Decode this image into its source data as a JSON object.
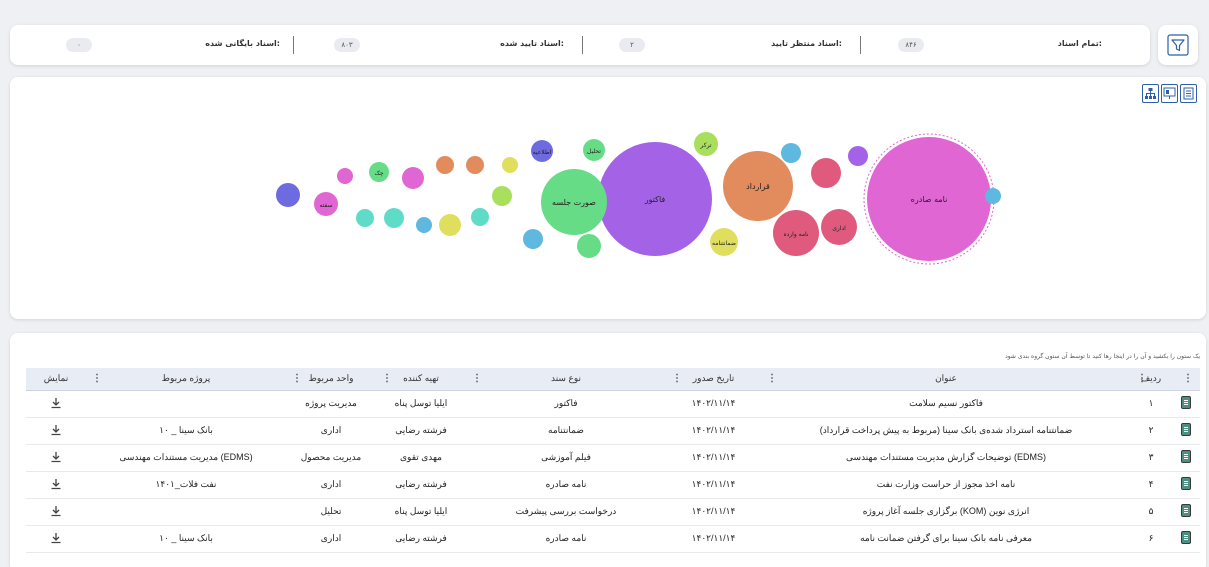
{
  "stats": {
    "all_docs": {
      "label": "تمام اسناد:",
      "value": "۸۴۶"
    },
    "pending": {
      "label": "اسناد منتظر تایید:",
      "value": "۲"
    },
    "approved": {
      "label": "اسناد تایید شده:",
      "value": "۸۰۳"
    },
    "archived": {
      "label": "اسناد بایگانی شده:",
      "value": "۰"
    }
  },
  "icons": {
    "filter": "filter-icon",
    "view_icons": [
      "document-icon",
      "presentation-icon",
      "org-chart-icon"
    ],
    "download": "download-icon"
  },
  "bubbles": [
    {
      "label": "نامه صادره",
      "color": "#e066d3"
    },
    {
      "label": "فاکتور",
      "color": "#a463e6"
    },
    {
      "label": "قرارداد",
      "color": "#e28c5d"
    },
    {
      "label": "صورت جلسه",
      "color": "#66dc86"
    },
    {
      "label": "نامه وارده",
      "color": "#e05a7e"
    },
    {
      "label": "اداری",
      "color": "#e05a7e"
    },
    {
      "label": "ترکر",
      "color": "#a8df5d"
    },
    {
      "label": "تحلیل",
      "color": "#66dc86"
    },
    {
      "label": "ضمانتنامه",
      "color": "#e0df5d"
    },
    {
      "label": "اطلاعیه",
      "color": "#6e6be0"
    },
    {
      "label": "چک",
      "color": "#66dc86"
    },
    {
      "label": "سفته",
      "color": "#e066d3"
    },
    {
      "label": "",
      "color": "#5fb8e0"
    },
    {
      "label": "",
      "color": "#5fb8e0"
    },
    {
      "label": "",
      "color": "#a463e6"
    },
    {
      "label": "",
      "color": "#e05a7e"
    },
    {
      "label": "",
      "color": "#e28c5d"
    },
    {
      "label": "",
      "color": "#e28c5d"
    },
    {
      "label": "",
      "color": "#e0df5d"
    },
    {
      "label": "",
      "color": "#e066d3"
    },
    {
      "label": "",
      "color": "#e066d3"
    },
    {
      "label": "",
      "color": "#6e6be0"
    },
    {
      "label": "",
      "color": "#5fdcc8"
    },
    {
      "label": "",
      "color": "#66dc86"
    },
    {
      "label": "",
      "color": "#5fb8e0"
    },
    {
      "label": "",
      "color": "#e0df5d"
    },
    {
      "label": "",
      "color": "#5fdcc8"
    },
    {
      "label": "",
      "color": "#5fdcc8"
    },
    {
      "label": "",
      "color": "#a8df5d"
    },
    {
      "label": "",
      "color": "#5fb8e0"
    },
    {
      "label": "",
      "color": "#66dc86"
    }
  ],
  "table": {
    "hint": "یک ستون را بکشید و آن را در اینجا رها کنید تا توسط آن ستون گروه بندی شود",
    "headers": {
      "show": "نمایش",
      "project": "پروژه مربوط",
      "unit": "واحد مربوط",
      "creator": "تهیه کننده",
      "type": "نوع سند",
      "date": "تاریخ صدور",
      "title": "عنوان",
      "row": "ردیف"
    },
    "rows": [
      {
        "row": "۱",
        "title": "فاکتور نسیم سلامت",
        "date": "۱۴۰۲/۱۱/۱۴",
        "type": "فاکتور",
        "creator": "ایلیا توسل پناه",
        "unit": "مدیریت پروژه",
        "project": ""
      },
      {
        "row": "۲",
        "title": "ضمانتنامه استرداد شده‌ی بانک سینا (مربوط به پیش پرداخت قرارداد)",
        "date": "۱۴۰۲/۱۱/۱۴",
        "type": "ضمانتنامه",
        "creator": "فرشته رضایی",
        "unit": "اداری",
        "project": "بانک سینا _ ۱۰"
      },
      {
        "row": "۳",
        "title": "توضیحات گزارش مدیریت مستندات مهندسی (EDMS)",
        "date": "۱۴۰۲/۱۱/۱۴",
        "type": "فیلم آموزشی",
        "creator": "مهدی تقوی",
        "unit": "مدیریت محصول",
        "project": "مدیریت مستندات مهندسی (EDMS)"
      },
      {
        "row": "۴",
        "title": "نامه اخذ مجوز از حراست وزارت نفت",
        "date": "۱۴۰۲/۱۱/۱۴",
        "type": "نامه صادره",
        "creator": "فرشته رضایی",
        "unit": "اداری",
        "project": "نفت فلات_۱۴۰۱"
      },
      {
        "row": "۵",
        "title": "برگزاری جلسه آغاز پروژه (KOM) انرژی نوین",
        "date": "۱۴۰۲/۱۱/۱۴",
        "type": "درخواست بررسی پیشرفت",
        "creator": "ایلیا توسل پناه",
        "unit": "تحلیل",
        "project": ""
      },
      {
        "row": "۶",
        "title": "معرفی نامه بانک سینا برای گرفتن ضمانت نامه",
        "date": "۱۴۰۲/۱۱/۱۴",
        "type": "نامه صادره",
        "creator": "فرشته رضایی",
        "unit": "اداری",
        "project": "بانک سینا _ ۱۰"
      }
    ]
  }
}
